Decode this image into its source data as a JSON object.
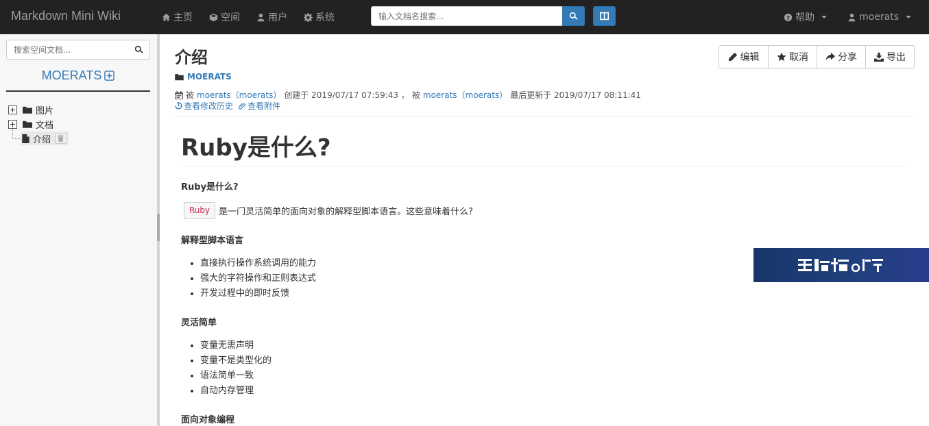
{
  "navbar": {
    "brand": "Markdown Mini Wiki",
    "links": [
      {
        "label": "主页",
        "icon": "home-icon"
      },
      {
        "label": "空间",
        "icon": "cube-icon"
      },
      {
        "label": "用户",
        "icon": "user-icon"
      },
      {
        "label": "系统",
        "icon": "gear-icon"
      }
    ],
    "search_placeholder": "输入文档名搜索...",
    "help_label": "帮助",
    "user_label": "moerats"
  },
  "sidebar": {
    "search_placeholder": "搜索空间文档...",
    "space_name": "MOERATS",
    "tree": [
      {
        "label": "图片",
        "type": "folder"
      },
      {
        "label": "文档",
        "type": "folder"
      },
      {
        "label": "介绍",
        "type": "document"
      }
    ]
  },
  "document": {
    "title": "介绍",
    "space": "MOERATS",
    "meta": {
      "by": "被",
      "creator": "moerats（moerats）",
      "created_text": "创建于 2019/07/17 07:59:43 ，",
      "by2": "被",
      "updater": "moerats（moerats）",
      "updated_text": "最后更新于 2019/07/17 08:11:41"
    },
    "history_link": "查看修改历史",
    "attachments_link": "查看附件",
    "actions": {
      "edit": "编辑",
      "cancel": "取消",
      "share": "分享",
      "export": "导出"
    }
  },
  "content": {
    "h1": "Ruby是什么?",
    "h4_intro": "Ruby是什么?",
    "code": "Ruby",
    "intro_text": "是一门灵活简单的面向对象的解释型脚本语言。这些意味着什么?",
    "h4_interpreted": "解释型脚本语言",
    "list_interpreted": [
      "直接执行操作系统调用的能力",
      "强大的字符操作和正则表达式",
      "开发过程中的即时反馈"
    ],
    "h4_flexible": "灵活简单",
    "list_flexible": [
      "变量无需声明",
      "变量不是类型化的",
      "语法简单一致",
      "自动内存管理"
    ],
    "h4_oop": "面向对象编程"
  },
  "colors": {
    "navbar_bg": "#222222",
    "primary": "#337ab7",
    "sidebar_bg": "#f7f7f7"
  }
}
